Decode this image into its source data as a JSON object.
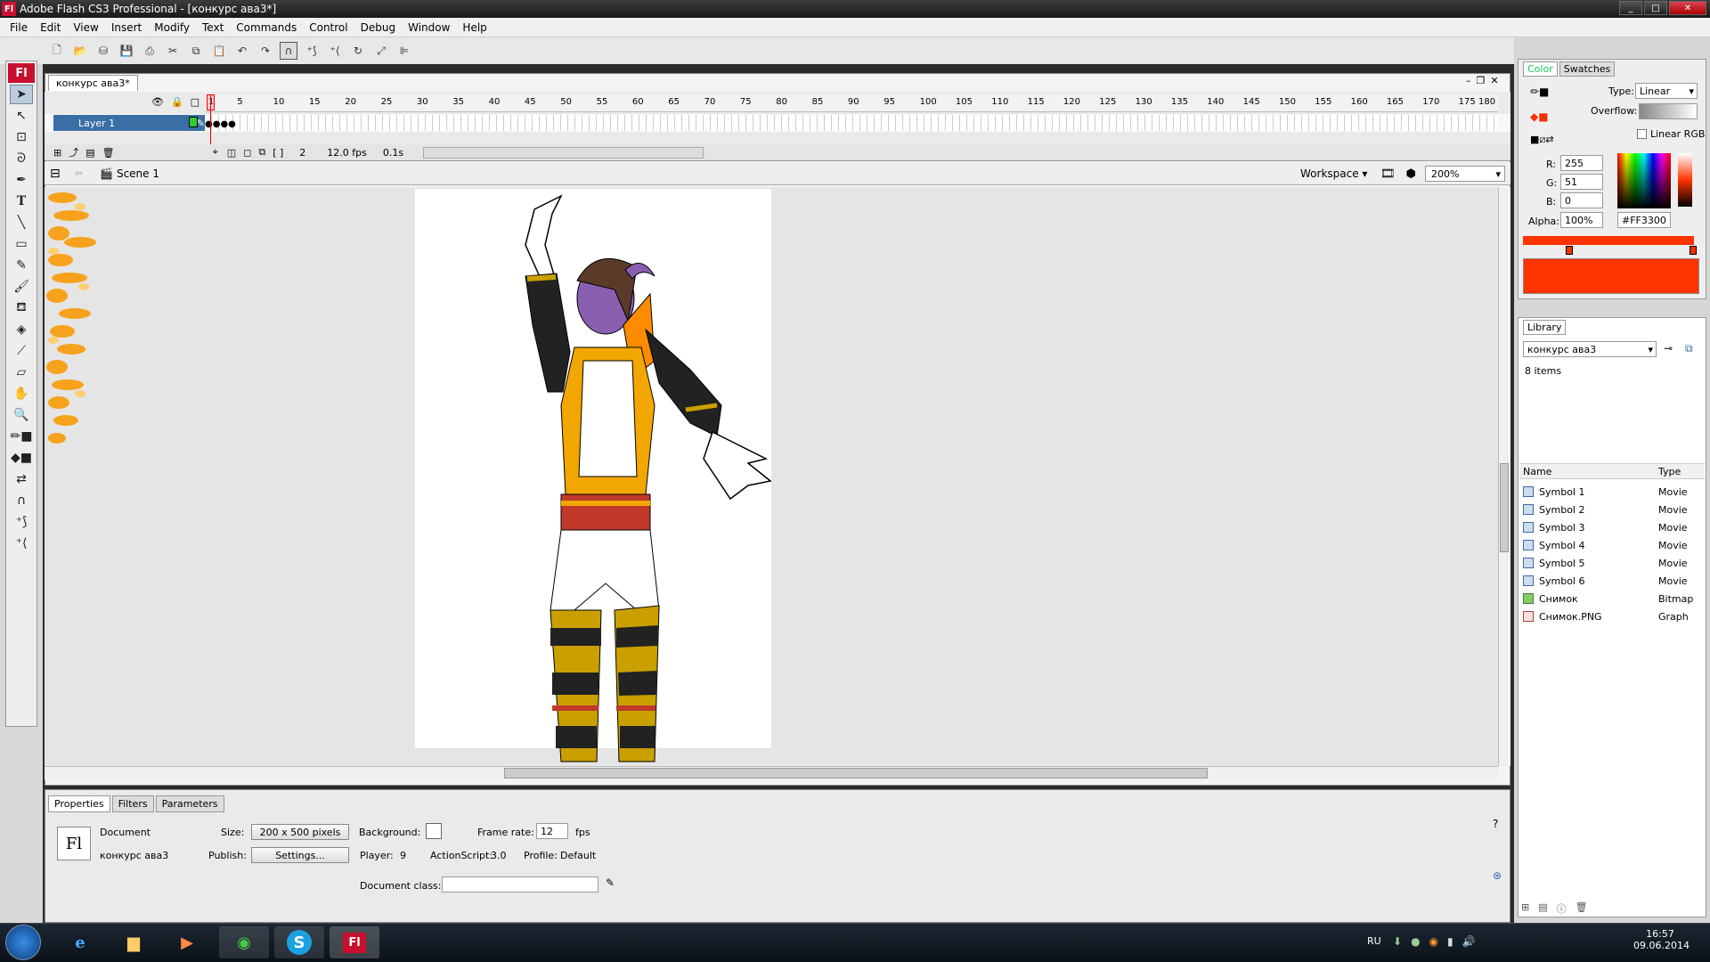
{
  "window": {
    "title": "Adobe Flash CS3 Professional - [конкурс ава3*]",
    "logo": "Fl"
  },
  "menu": [
    "File",
    "Edit",
    "View",
    "Insert",
    "Modify",
    "Text",
    "Commands",
    "Control",
    "Debug",
    "Window",
    "Help"
  ],
  "toolbar_icons": [
    "new-icon",
    "open-icon",
    "bridge-icon",
    "save-icon",
    "print-icon",
    "cut-icon",
    "copy-icon",
    "paste-icon",
    "undo-icon",
    "redo-icon",
    "snap-magnet-icon",
    "smooth-icon",
    "straighten-icon",
    "rotate-icon",
    "scale-icon",
    "align-icon"
  ],
  "tools": [
    "arrow-icon",
    "subselect-icon",
    "free-transform-icon",
    "lasso-icon",
    "pen-icon",
    "text-icon",
    "line-icon",
    "rectangle-icon",
    "pencil-icon",
    "brush-icon",
    "ink-bottle-icon",
    "paint-bucket-icon",
    "eyedropper-icon",
    "eraser-icon",
    "hand-icon",
    "zoom-icon"
  ],
  "document": {
    "tab": "конкурс ава3*",
    "layer": "Layer 1",
    "ruler_ticks": [
      "1",
      "5",
      "10",
      "15",
      "20",
      "25",
      "30",
      "35",
      "40",
      "45",
      "50",
      "55",
      "60",
      "65",
      "70",
      "75",
      "80",
      "85",
      "90",
      "95",
      "100",
      "105",
      "110",
      "115",
      "120",
      "125",
      "130",
      "135",
      "140",
      "145",
      "150",
      "155",
      "160",
      "165",
      "170",
      "175",
      "180"
    ],
    "current_frame": "2",
    "fps": "12.0 fps",
    "time": "0.1s",
    "scene": "Scene 1",
    "workspace": "Workspace",
    "zoom": "200%"
  },
  "properties": {
    "tabs": [
      "Properties",
      "Filters",
      "Parameters"
    ],
    "doc_label": "Document",
    "doc_name": "конкурс ава3",
    "size_label": "Size:",
    "size_value": "200 x 500 pixels",
    "background_label": "Background:",
    "frame_rate_label": "Frame rate:",
    "frame_rate": "12",
    "fps_unit": "fps",
    "publish_label": "Publish:",
    "settings_btn": "Settings...",
    "player_label": "Player:",
    "player": "9",
    "as_label": "ActionScript:",
    "as_value": "3.0",
    "profile_label": "Profile:",
    "profile": "Default",
    "doc_class_label": "Document class:",
    "doc_class": ""
  },
  "color": {
    "tabs": [
      "Color",
      "Swatches"
    ],
    "type_label": "Type:",
    "type": "Linear",
    "overflow_label": "Overflow:",
    "linear_rgb": "Linear RGB",
    "r_label": "R:",
    "r": "255",
    "g_label": "G:",
    "g": "51",
    "b_label": "B:",
    "b": "0",
    "alpha_label": "Alpha:",
    "alpha": "100%",
    "hex": "#FF3300",
    "swatch_color": "#ff3300"
  },
  "library": {
    "tab": "Library",
    "doc": "конкурс ава3",
    "count": "8 items",
    "col_name": "Name",
    "col_type": "Type",
    "items": [
      {
        "name": "Symbol 1",
        "type": "Movie"
      },
      {
        "name": "Symbol 2",
        "type": "Movie"
      },
      {
        "name": "Symbol 3",
        "type": "Movie"
      },
      {
        "name": "Symbol 4",
        "type": "Movie"
      },
      {
        "name": "Symbol 5",
        "type": "Movie"
      },
      {
        "name": "Symbol 6",
        "type": "Movie"
      },
      {
        "name": "Снимок",
        "type": "Bitmap"
      },
      {
        "name": "Снимок.PNG",
        "type": "Graph"
      }
    ]
  },
  "taskbar": {
    "lang": "RU",
    "time": "16:57",
    "date": "09.06.2014",
    "apps": [
      "internet-explorer-icon",
      "explorer-folder-icon",
      "media-player-icon",
      "chrome-icon",
      "skype-icon",
      "flash-icon"
    ]
  }
}
